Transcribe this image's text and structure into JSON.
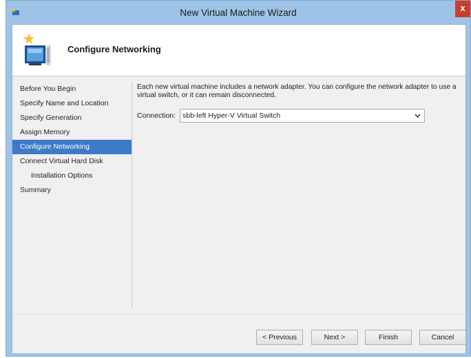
{
  "window": {
    "title": "New Virtual Machine Wizard",
    "close_glyph": "x"
  },
  "header": {
    "title": "Configure Networking"
  },
  "nav": {
    "items": [
      {
        "label": "Before You Begin",
        "active": false,
        "sub": false
      },
      {
        "label": "Specify Name and Location",
        "active": false,
        "sub": false
      },
      {
        "label": "Specify Generation",
        "active": false,
        "sub": false
      },
      {
        "label": "Assign Memory",
        "active": false,
        "sub": false
      },
      {
        "label": "Configure Networking",
        "active": true,
        "sub": false
      },
      {
        "label": "Connect Virtual Hard Disk",
        "active": false,
        "sub": false
      },
      {
        "label": "Installation Options",
        "active": false,
        "sub": true
      },
      {
        "label": "Summary",
        "active": false,
        "sub": false
      }
    ]
  },
  "content": {
    "description": "Each new virtual machine includes a network adapter. You can configure the network adapter to use a virtual switch, or it can remain disconnected.",
    "connection_label": "Connection:",
    "connection_value": "sbb-left Hyper-V Virtual Switch"
  },
  "buttons": {
    "previous": "< Previous",
    "next": "Next >",
    "finish": "Finish",
    "cancel": "Cancel"
  },
  "colors": {
    "frame": "#9dc3e6",
    "selection": "#3d7bc7",
    "close": "#c7402d"
  },
  "icons": {
    "title": "hyperv-wizard-icon",
    "header": "computer-sparkle-icon",
    "dropdown": "chevron-down-icon"
  }
}
